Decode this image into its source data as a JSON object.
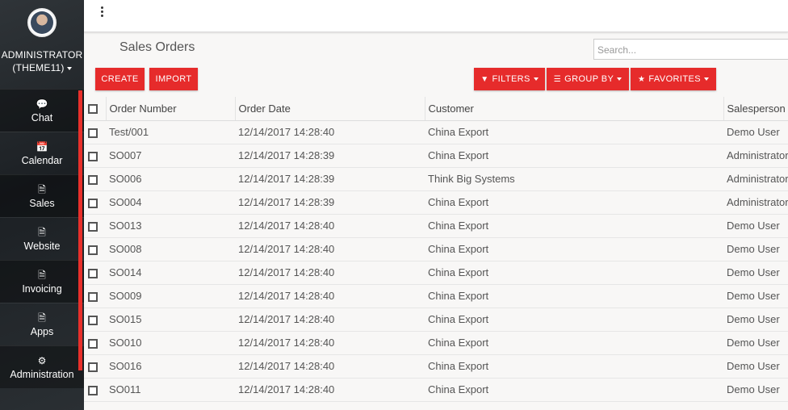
{
  "sidebar": {
    "user": "ADMINISTRATOR (THEME11)",
    "items": [
      {
        "label": "Chat",
        "icon": "chat-icon",
        "glyph": "💬"
      },
      {
        "label": "Calendar",
        "icon": "calendar-icon",
        "glyph": "📅"
      },
      {
        "label": "Sales",
        "icon": "document-icon",
        "glyph": "🗎"
      },
      {
        "label": "Website",
        "icon": "document-icon",
        "glyph": "🗎"
      },
      {
        "label": "Invoicing",
        "icon": "document-icon",
        "glyph": "🗎"
      },
      {
        "label": "Apps",
        "icon": "document-icon",
        "glyph": "🗎"
      },
      {
        "label": "Administration",
        "icon": "gear-icon",
        "glyph": "⚙"
      }
    ]
  },
  "header": {
    "title": "Sales Orders",
    "search_placeholder": "Search..."
  },
  "toolbar": {
    "create": "CREATE",
    "import": "IMPORT",
    "filters": "FILTERS",
    "group_by": "GROUP BY",
    "favorites": "FAVORITES"
  },
  "table": {
    "columns": [
      "Order Number",
      "Order Date",
      "Customer",
      "Salesperson"
    ],
    "rows": [
      [
        "Test/001",
        "12/14/2017 14:28:40",
        "China Export",
        "Demo User"
      ],
      [
        "SO007",
        "12/14/2017 14:28:39",
        "China Export",
        "Administrator"
      ],
      [
        "SO006",
        "12/14/2017 14:28:39",
        "Think Big Systems",
        "Administrator"
      ],
      [
        "SO004",
        "12/14/2017 14:28:39",
        "China Export",
        "Administrator"
      ],
      [
        "SO013",
        "12/14/2017 14:28:40",
        "China Export",
        "Demo User"
      ],
      [
        "SO008",
        "12/14/2017 14:28:40",
        "China Export",
        "Demo User"
      ],
      [
        "SO014",
        "12/14/2017 14:28:40",
        "China Export",
        "Demo User"
      ],
      [
        "SO009",
        "12/14/2017 14:28:40",
        "China Export",
        "Demo User"
      ],
      [
        "SO015",
        "12/14/2017 14:28:40",
        "China Export",
        "Demo User"
      ],
      [
        "SO010",
        "12/14/2017 14:28:40",
        "China Export",
        "Demo User"
      ],
      [
        "SO016",
        "12/14/2017 14:28:40",
        "China Export",
        "Demo User"
      ],
      [
        "SO011",
        "12/14/2017 14:28:40",
        "China Export",
        "Demo User"
      ]
    ]
  },
  "colors": {
    "accent": "#e62b2b",
    "sidebar_bg": "#24292d"
  }
}
